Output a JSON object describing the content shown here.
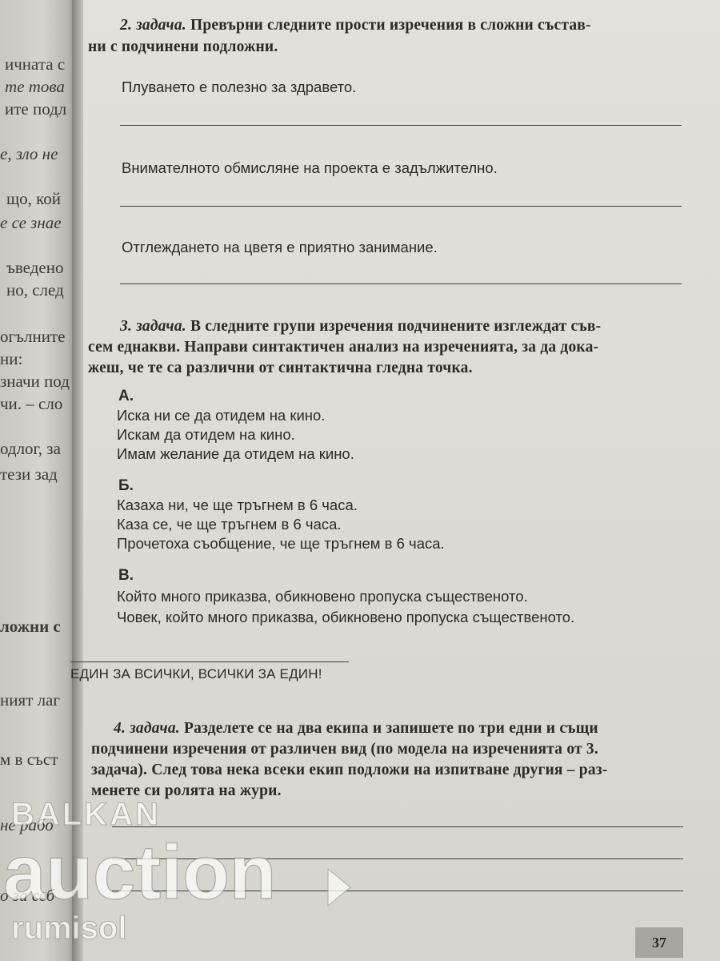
{
  "left_page": {
    "fragments": [
      "ичната с",
      "те това",
      "ите подл",
      "е, зло не",
      "що, кой",
      "е се знае",
      "ъведено",
      "но, след",
      "огълните",
      "ни:",
      "значи под",
      "чи. – сло",
      "одлог, за",
      "тези зад",
      "ложни с",
      "ният лаг",
      "м в съст",
      "не рабо",
      "о за себ"
    ]
  },
  "task2": {
    "number": "2. задача.",
    "text_line1": "Превърни следните прости изречения в сложни състав-",
    "text_line2": "ни с подчинени подложни.",
    "sentences": [
      "Плуването е полезно за здравето.",
      "Внимателното обмисляне на проекта е задължително.",
      "Отглеждането на цветя е приятно занимание."
    ]
  },
  "task3": {
    "number": "3. задача.",
    "text_line1": "В следните групи изречения подчинените изглеждат съв-",
    "text_line2": "сем еднакви. Направи синтактичен анализ на изреченията, за да дока-",
    "text_line3": "жеш, че те са различни от синтактична гледна точка.",
    "groups": [
      {
        "label": "А.",
        "lines": [
          "Иска ни се да отидем на кино.",
          "Искам да отидем на кино.",
          "Имам желание да отидем на кино."
        ]
      },
      {
        "label": "Б.",
        "lines": [
          "Казаха ни, че ще тръгнем в 6 часа.",
          "Каза се, че ще тръгнем в 6 часа.",
          "Прочетоха съобщение, че ще тръгнем в 6 часа."
        ]
      },
      {
        "label": "В.",
        "lines": [
          "Който много приказва, обикновено пропуска същественото.",
          "Човек, който много приказва, обикновено пропуска същественото."
        ]
      }
    ]
  },
  "slogan": "ЕДИН ЗА ВСИЧКИ, ВСИЧКИ ЗА ЕДИН!",
  "task4": {
    "number": "4. задача.",
    "text_line1": "Разделете се на два екипа и запишете по три едни и същи",
    "text_line2": "подчинени изречения от различен вид (по модела на изреченията от 3.",
    "text_line3": "задача). След това нека всеки екип подложи на изпитване другия – раз-",
    "text_line4": "менете си ролята на жури."
  },
  "page_number": "37",
  "watermark": {
    "line1": "BALKAN",
    "line2": "auction",
    "line3": "rumisol",
    "color": "#ffffff"
  }
}
